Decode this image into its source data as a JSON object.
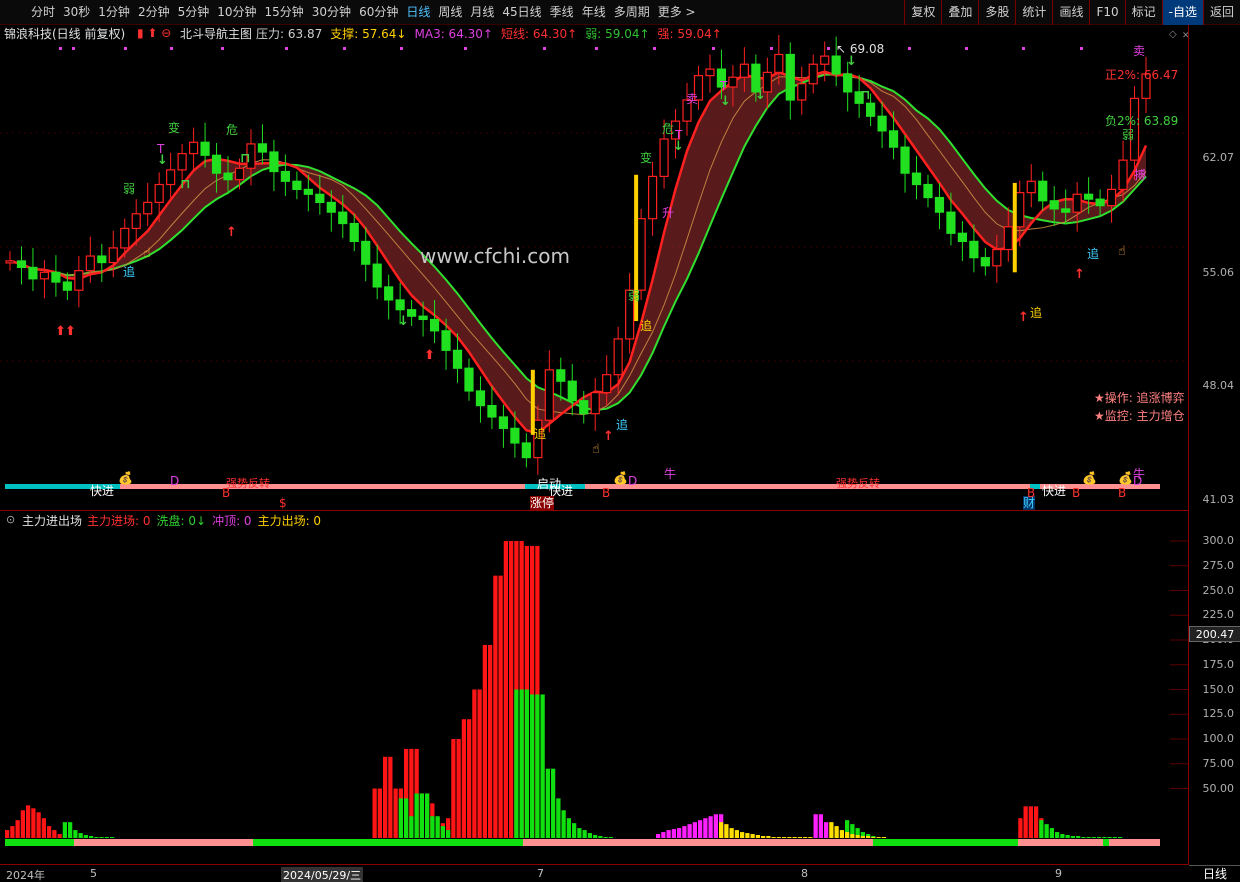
{
  "toolbar": {
    "periods": [
      "分时",
      "30秒",
      "1分钟",
      "2分钟",
      "5分钟",
      "10分钟",
      "15分钟",
      "30分钟",
      "60分钟",
      "日线",
      "周线",
      "月线",
      "45日线",
      "季线",
      "年线",
      "多周期",
      "更多 >"
    ],
    "active_period": "日线",
    "right_buttons": [
      "复权",
      "叠加",
      "多股",
      "统计",
      "画线",
      "F10",
      "标记",
      "-自选",
      "返回"
    ]
  },
  "main": {
    "title": "锦浪科技(日线 前复权)",
    "indicator_name": "北斗导航主图",
    "stats": [
      {
        "label": "压力: 63.87",
        "color": "#d0d0d0"
      },
      {
        "label": "支撑: 57.64↓",
        "color": "#ffd000"
      },
      {
        "label": "MA3: 64.30↑",
        "color": "#e040e0"
      },
      {
        "label": "短线: 64.30↑",
        "color": "#ff3030"
      },
      {
        "label": "弱: 59.04↑",
        "color": "#30c030"
      },
      {
        "label": "强: 59.04↑",
        "color": "#ff3030"
      }
    ],
    "watermark": "www.cfchi.com",
    "high_marker": "69.08",
    "price_labels": {
      "pos": "正2%: 66.47",
      "neg": "负2%: 63.89"
    },
    "ops_lines": [
      "★操作: 追涨博弈",
      "★监控: 主力增仓"
    ],
    "band_labels": [
      "强势反转",
      "强势反转"
    ],
    "signal_texts": {
      "zhui": "追",
      "ruo": "弱",
      "bian": "变",
      "wei": "危",
      "sheng": "升",
      "mai": "卖",
      "bo": "搏",
      "kuaijin": "快进",
      "qidong": "启动",
      "zhangting": "涨停",
      "cai": "财",
      "niu": "牛",
      "B": "B",
      "D": "D",
      "T": "T",
      "S": "$"
    }
  },
  "sub": {
    "title": "主力进出场",
    "stats": [
      {
        "label": "主力进场: 0",
        "color": "#ff3030"
      },
      {
        "label": "洗盘: 0↓",
        "color": "#30d030"
      },
      {
        "label": "冲顶: 0",
        "color": "#e040e0"
      },
      {
        "label": "主力出场: 0",
        "color": "#ffd000"
      }
    ]
  },
  "yaxis": {
    "main_ticks": [
      "62.07",
      "55.06",
      "48.04",
      "41.03"
    ],
    "sub_ticks": [
      "300.0",
      "275.0",
      "250.0",
      "225.0",
      "200.0",
      "175.0",
      "150.0",
      "125.0",
      "100.0",
      "75.00",
      "50.00"
    ],
    "cursor_value": "200.47",
    "period_label": "日线"
  },
  "xaxis": {
    "labels": [
      "2024年",
      "5",
      "2024/05/29/三",
      "7",
      "8",
      "9"
    ]
  },
  "chart_data": {
    "type": "candlestick",
    "main": {
      "y_ticks": [
        62.07,
        55.06,
        48.04,
        41.03
      ],
      "high": 69.08,
      "closes": [
        54.2,
        53.8,
        53.1,
        53.5,
        52.9,
        52.4,
        53.6,
        54.5,
        54.1,
        55.0,
        56.2,
        57.1,
        57.8,
        58.9,
        59.8,
        60.8,
        61.5,
        60.7,
        59.6,
        59.2,
        59.9,
        61.4,
        60.9,
        59.7,
        59.1,
        58.6,
        58.3,
        57.8,
        57.2,
        56.5,
        55.4,
        54.0,
        52.6,
        51.8,
        51.2,
        50.8,
        50.6,
        49.9,
        48.7,
        47.6,
        46.2,
        45.3,
        44.6,
        43.9,
        43.0,
        42.1,
        44.4,
        47.5,
        46.8,
        45.6,
        44.8,
        46.1,
        47.2,
        49.4,
        52.4,
        56.8,
        59.4,
        61.7,
        62.8,
        64.1,
        65.6,
        66.0,
        64.9,
        65.5,
        66.3,
        64.6,
        65.8,
        66.9,
        64.1,
        65.1,
        66.3,
        66.8,
        65.7,
        64.6,
        63.9,
        63.1,
        62.2,
        61.2,
        59.6,
        58.9,
        58.1,
        57.2,
        55.9,
        55.4,
        54.4,
        53.9,
        54.9,
        56.3,
        58.4,
        59.1,
        57.9,
        57.4,
        57.2,
        58.3,
        58.0,
        57.6,
        58.6,
        60.4,
        64.2,
        65.7
      ],
      "ma_fast_color": "#ff2020",
      "ma_slow_color": "#30e030"
    },
    "sub": {
      "y_ticks": [
        300,
        275,
        250,
        225,
        200,
        175,
        150,
        125,
        100,
        75,
        50
      ],
      "series": [
        {
          "name": "主力进场",
          "color": "#ff2020",
          "values": [
            5,
            8,
            18,
            26,
            33,
            20,
            8,
            4,
            3,
            2,
            1,
            1,
            1,
            0,
            0,
            0,
            0,
            0,
            0,
            0,
            0,
            0,
            0,
            0,
            0,
            0,
            0,
            0,
            0,
            0,
            0,
            0,
            0,
            0,
            0,
            0,
            0,
            0,
            0,
            0,
            0,
            0,
            0,
            0,
            0,
            0,
            0,
            0,
            0,
            0,
            0,
            0,
            55,
            82,
            52,
            90,
            20,
            10,
            8,
            60,
            125,
            150,
            200,
            270,
            308,
            308,
            295,
            0,
            0,
            0,
            0,
            0,
            0,
            0,
            0,
            0,
            0,
            0,
            0,
            0,
            0,
            0,
            0,
            0,
            0,
            0,
            0,
            0,
            0,
            0,
            0,
            0,
            0,
            0,
            0,
            0,
            0,
            0,
            0,
            0,
            0,
            0,
            0,
            0,
            0,
            0,
            0,
            0,
            0,
            0,
            0,
            0,
            0,
            0,
            0,
            0,
            0,
            0,
            0,
            0,
            0,
            0,
            0,
            0,
            0,
            0,
            0,
            0,
            0,
            0,
            0,
            0,
            0,
            0,
            0,
            0,
            0,
            0,
            0,
            0,
            0,
            0,
            0,
            0,
            0,
            0,
            0,
            0,
            0,
            0,
            0,
            0,
            0,
            0,
            0,
            0,
            0,
            0,
            0,
            0,
            0,
            0,
            0,
            0,
            0,
            0,
            0,
            0,
            0,
            0,
            0,
            0,
            0,
            0,
            0,
            0,
            0,
            0,
            0,
            0,
            0,
            0,
            0,
            0,
            0,
            0,
            0,
            0,
            0,
            0,
            0,
            0,
            0,
            0,
            0,
            0,
            0,
            0,
            0,
            0,
            0,
            0,
            0,
            0,
            0,
            0,
            0,
            0,
            0,
            0,
            0,
            0,
            0,
            0,
            0,
            0,
            0,
            0,
            0,
            0,
            0,
            0,
            0,
            0,
            0,
            0,
            0,
            0,
            20,
            32,
            32,
            0,
            0,
            0,
            0,
            0,
            0,
            0,
            0,
            0,
            0,
            0,
            0,
            0,
            0,
            0,
            0,
            0,
            0,
            0,
            0,
            0,
            0,
            0,
            0,
            0,
            0,
            0,
            0,
            0,
            0,
            0,
            0,
            0,
            0,
            0,
            0,
            0,
            0,
            0,
            0,
            0,
            0,
            0,
            0,
            0,
            0,
            0,
            0,
            0,
            0,
            0,
            0,
            0,
            0,
            0,
            0,
            0,
            0,
            0,
            0,
            0,
            0,
            0,
            0,
            0,
            0,
            0,
            0,
            0,
            0,
            0,
            0,
            0,
            0,
            0,
            0,
            0,
            0,
            0,
            0,
            0,
            0,
            0,
            0,
            0,
            0,
            0,
            0,
            0,
            0,
            0,
            0,
            0,
            0,
            0,
            0,
            0,
            0,
            0,
            0,
            0,
            0,
            0,
            0,
            0,
            0,
            0,
            0,
            0,
            0,
            0,
            0,
            0,
            0,
            0,
            0,
            0,
            0,
            0,
            0,
            0,
            0,
            0,
            0,
            0,
            0,
            0,
            0,
            0,
            0,
            0,
            0,
            0,
            0,
            0,
            0,
            0,
            0,
            0,
            0,
            0,
            0,
            0,
            0,
            0,
            0,
            0,
            0,
            0,
            0,
            0,
            0,
            0,
            0,
            0,
            0,
            0,
            0,
            0,
            0,
            0,
            0,
            0,
            0,
            0,
            0,
            0,
            0,
            0,
            0,
            0,
            0,
            0,
            0,
            0,
            0,
            0,
            0,
            0,
            0,
            0,
            0,
            0,
            0,
            0,
            0,
            0,
            0,
            0,
            0,
            0,
            0,
            0,
            0,
            0,
            0,
            0,
            0,
            0,
            0,
            0,
            0,
            0,
            0,
            0,
            0,
            0,
            0,
            0,
            0,
            0,
            0,
            0,
            0,
            0
          ]
        },
        {
          "name": "洗盘",
          "color": "#20e020",
          "values": [
            0,
            0,
            0,
            0,
            0,
            16,
            10,
            5,
            3,
            2,
            1,
            1,
            0,
            0,
            0,
            0,
            0,
            0,
            0,
            0,
            0,
            0,
            0,
            0,
            0,
            0,
            0,
            0,
            0,
            0,
            0,
            0,
            0,
            0,
            0,
            0,
            0,
            0,
            0,
            0,
            0,
            0,
            0,
            0,
            0,
            0,
            0,
            0,
            0,
            0,
            0,
            0,
            0,
            0,
            40,
            45,
            22,
            8,
            4,
            0,
            0,
            0,
            0,
            0,
            0,
            0,
            0,
            155,
            145,
            75,
            45,
            28,
            15,
            8,
            5,
            3,
            2,
            1,
            0,
            0,
            0,
            0,
            0,
            0,
            0,
            0,
            0,
            0,
            0,
            0,
            0,
            0,
            0,
            0,
            0,
            0,
            0,
            0,
            0,
            0,
            0,
            0,
            0,
            0,
            0,
            0,
            0,
            0,
            0,
            0,
            0,
            0,
            0,
            0,
            0,
            0,
            0,
            0,
            0,
            0,
            0,
            0,
            0,
            0,
            0,
            0,
            0,
            0,
            0,
            0,
            0,
            0,
            0,
            0,
            0,
            0,
            0,
            0,
            0,
            0,
            0,
            0,
            0,
            0,
            0,
            0,
            0,
            0,
            0,
            0,
            0,
            0,
            0,
            0,
            0,
            0,
            0,
            0,
            0,
            0,
            0,
            0,
            0,
            0,
            0,
            0,
            0,
            0,
            0,
            0,
            0,
            0,
            0,
            0,
            0,
            0,
            0,
            0,
            0,
            0,
            0,
            0,
            0,
            0,
            0,
            0,
            0,
            0,
            0,
            0,
            0,
            0,
            0,
            0,
            0,
            0,
            0,
            0,
            0,
            0,
            0,
            0,
            0,
            0,
            0,
            0,
            0,
            0,
            0,
            0,
            0,
            0,
            0,
            0,
            0,
            0,
            0,
            0,
            0,
            0,
            0,
            0,
            0,
            0,
            0,
            0,
            0,
            0,
            0,
            0,
            0,
            0,
            0,
            0,
            0,
            0,
            0,
            0,
            0,
            0,
            0,
            0,
            0,
            0,
            0,
            0,
            0,
            0,
            0,
            0,
            0,
            0,
            0,
            0,
            0,
            0,
            0,
            0,
            0,
            0,
            0,
            0,
            0,
            0,
            0,
            0,
            0,
            0,
            0,
            0,
            0,
            0,
            0,
            0,
            0,
            0,
            0,
            0,
            0,
            0,
            0,
            0,
            0,
            0,
            0,
            0,
            0,
            0,
            0,
            0,
            0,
            0,
            0,
            0,
            0,
            0,
            0,
            0,
            0,
            0,
            0,
            0,
            0,
            0,
            0,
            0,
            0,
            0,
            0,
            0,
            0,
            0,
            0,
            0,
            0,
            0,
            0,
            0,
            0,
            0,
            0,
            0,
            0,
            0,
            0,
            0,
            0,
            0,
            0,
            0,
            0,
            0,
            0,
            0,
            0,
            0,
            0,
            0,
            0,
            0,
            0,
            0,
            0,
            0,
            0,
            0,
            0,
            0,
            0,
            0,
            0,
            0,
            0,
            0,
            0,
            0,
            0,
            0,
            0,
            0,
            0,
            0,
            0,
            0,
            0,
            0,
            0,
            0,
            0,
            0,
            0,
            0,
            0,
            0,
            0,
            0,
            0,
            0,
            0,
            0,
            0,
            0,
            0,
            0,
            0,
            0,
            0,
            0,
            0,
            0,
            0,
            0,
            0,
            0,
            0,
            0,
            0,
            0,
            0,
            0,
            0,
            0,
            0,
            0,
            0,
            0,
            0,
            0,
            0,
            0,
            0,
            0,
            0,
            0,
            0,
            0,
            0,
            0,
            0,
            0,
            0,
            0,
            0,
            0,
            0,
            0,
            0,
            0,
            0,
            0,
            0,
            0,
            0,
            0,
            0,
            0,
            0,
            0,
            0,
            0,
            0,
            0,
            0,
            0,
            0,
            0,
            0,
            0,
            0,
            0,
            0,
            0,
            0,
            0,
            0,
            0,
            0,
            0,
            0
          ]
        }
      ]
    }
  }
}
